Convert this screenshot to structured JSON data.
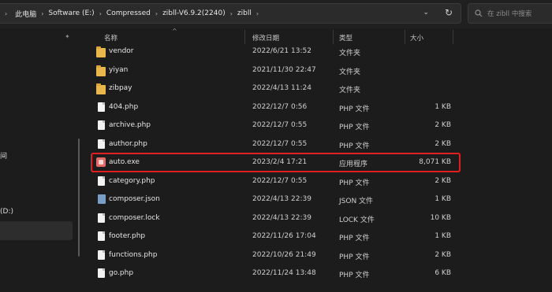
{
  "address_bar": {
    "breadcrumbs": [
      "此电脑",
      "Software (E:)",
      "Compressed",
      "zibll-V6.9.2(2240)",
      "zibll"
    ]
  },
  "search": {
    "placeholder": "在 zibll 中搜索"
  },
  "nav": {
    "fragments": [
      "间",
      "(D:)"
    ]
  },
  "columns": {
    "name": "名称",
    "date": "修改日期",
    "type": "类型",
    "size": "大小"
  },
  "files": [
    {
      "name": "vendor",
      "date": "2022/6/21 13:52",
      "type": "文件夹",
      "size": "",
      "icon": "folder-icon"
    },
    {
      "name": "yiyan",
      "date": "2021/11/30 22:47",
      "type": "文件夹",
      "size": "",
      "icon": "folder-icon"
    },
    {
      "name": "zibpay",
      "date": "2022/4/13 11:24",
      "type": "文件夹",
      "size": "",
      "icon": "folder-icon"
    },
    {
      "name": "404.php",
      "date": "2022/12/7 0:56",
      "type": "PHP 文件",
      "size": "1 KB",
      "icon": "file-icon"
    },
    {
      "name": "archive.php",
      "date": "2022/12/7 0:55",
      "type": "PHP 文件",
      "size": "2 KB",
      "icon": "file-icon"
    },
    {
      "name": "author.php",
      "date": "2022/12/7 0:55",
      "type": "PHP 文件",
      "size": "2 KB",
      "icon": "file-icon"
    },
    {
      "name": "auto.exe",
      "date": "2023/2/4 17:21",
      "type": "应用程序",
      "size": "8,071 KB",
      "icon": "exe-icon"
    },
    {
      "name": "category.php",
      "date": "2022/12/7 0:55",
      "type": "PHP 文件",
      "size": "2 KB",
      "icon": "file-icon"
    },
    {
      "name": "composer.json",
      "date": "2022/4/13 22:39",
      "type": "JSON 文件",
      "size": "1 KB",
      "icon": "json-icon"
    },
    {
      "name": "composer.lock",
      "date": "2022/4/13 22:39",
      "type": "LOCK 文件",
      "size": "10 KB",
      "icon": "file-icon"
    },
    {
      "name": "footer.php",
      "date": "2022/11/26 17:04",
      "type": "PHP 文件",
      "size": "1 KB",
      "icon": "file-icon"
    },
    {
      "name": "functions.php",
      "date": "2022/10/26 21:49",
      "type": "PHP 文件",
      "size": "2 KB",
      "icon": "file-icon"
    },
    {
      "name": "go.php",
      "date": "2022/11/24 13:48",
      "type": "PHP 文件",
      "size": "6 KB",
      "icon": "file-icon"
    }
  ],
  "highlight_color": "#e02020"
}
